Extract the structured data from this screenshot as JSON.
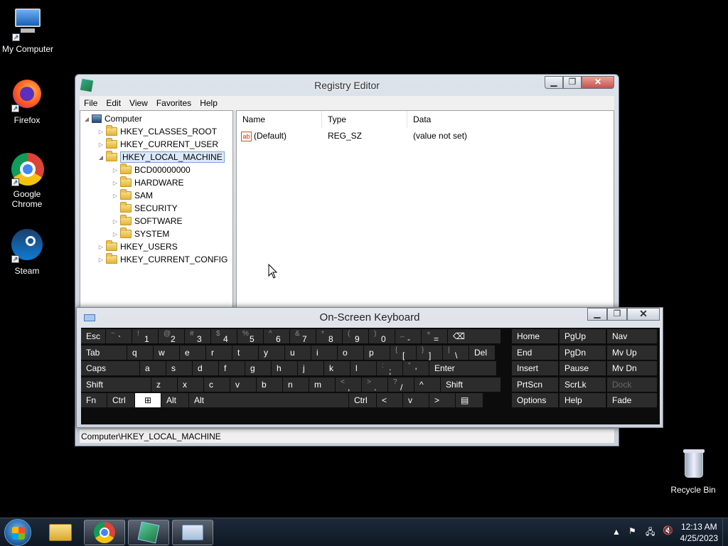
{
  "desktop": {
    "icons": [
      {
        "label": "My Computer",
        "icon": "computer-icon"
      },
      {
        "label": "Firefox",
        "icon": "firefox-icon"
      },
      {
        "label": "Google Chrome",
        "icon": "chrome-icon"
      },
      {
        "label": "Steam",
        "icon": "steam-icon"
      },
      {
        "label": "Recycle Bin",
        "icon": "recycle-bin-icon"
      }
    ]
  },
  "registry": {
    "title": "Registry Editor",
    "menu": [
      "File",
      "Edit",
      "View",
      "Favorites",
      "Help"
    ],
    "tree": {
      "root": "Computer",
      "hives": [
        "HKEY_CLASSES_ROOT",
        "HKEY_CURRENT_USER",
        "HKEY_LOCAL_MACHINE",
        "HKEY_USERS",
        "HKEY_CURRENT_CONFIG"
      ],
      "selected": "HKEY_LOCAL_MACHINE",
      "hklm_children": [
        "BCD00000000",
        "HARDWARE",
        "SAM",
        "SECURITY",
        "SOFTWARE",
        "SYSTEM"
      ]
    },
    "columns": [
      "Name",
      "Type",
      "Data"
    ],
    "values": [
      {
        "name": "(Default)",
        "type": "REG_SZ",
        "data": "(value not set)"
      }
    ],
    "status": "Computer\\HKEY_LOCAL_MACHINE"
  },
  "osk": {
    "title": "On-Screen Keyboard",
    "rows": [
      [
        "Esc",
        "~ `",
        "! 1",
        "@ 2",
        "# 3",
        "$ 4",
        "% 5",
        "^ 6",
        "& 7",
        "* 8",
        "( 9",
        ") 0",
        "_ -",
        "+ =",
        "⌫"
      ],
      [
        "Tab",
        "q",
        "w",
        "e",
        "r",
        "t",
        "y",
        "u",
        "i",
        "o",
        "p",
        "{ [",
        "} ]",
        "| \\",
        "Del"
      ],
      [
        "Caps",
        "a",
        "s",
        "d",
        "f",
        "g",
        "h",
        "j",
        "k",
        "l",
        ": ;",
        "\" '",
        "Enter"
      ],
      [
        "Shift",
        "z",
        "x",
        "c",
        "v",
        "b",
        "n",
        "m",
        "< ,",
        "> .",
        "? /",
        "^",
        "Shift"
      ],
      [
        "Fn",
        "Ctrl",
        "⊞",
        "Alt",
        "Alt",
        "Ctrl",
        "<",
        "v",
        ">",
        "▤"
      ]
    ],
    "nav": [
      [
        "Home",
        "PgUp",
        "Nav"
      ],
      [
        "End",
        "PgDn",
        "Mv Up"
      ],
      [
        "Insert",
        "Pause",
        "Mv Dn"
      ],
      [
        "PrtScn",
        "ScrLk",
        "Dock"
      ],
      [
        "Options",
        "Help",
        "Fade"
      ]
    ]
  },
  "taskbar": {
    "time": "12:13 AM",
    "date": "4/25/2023"
  }
}
